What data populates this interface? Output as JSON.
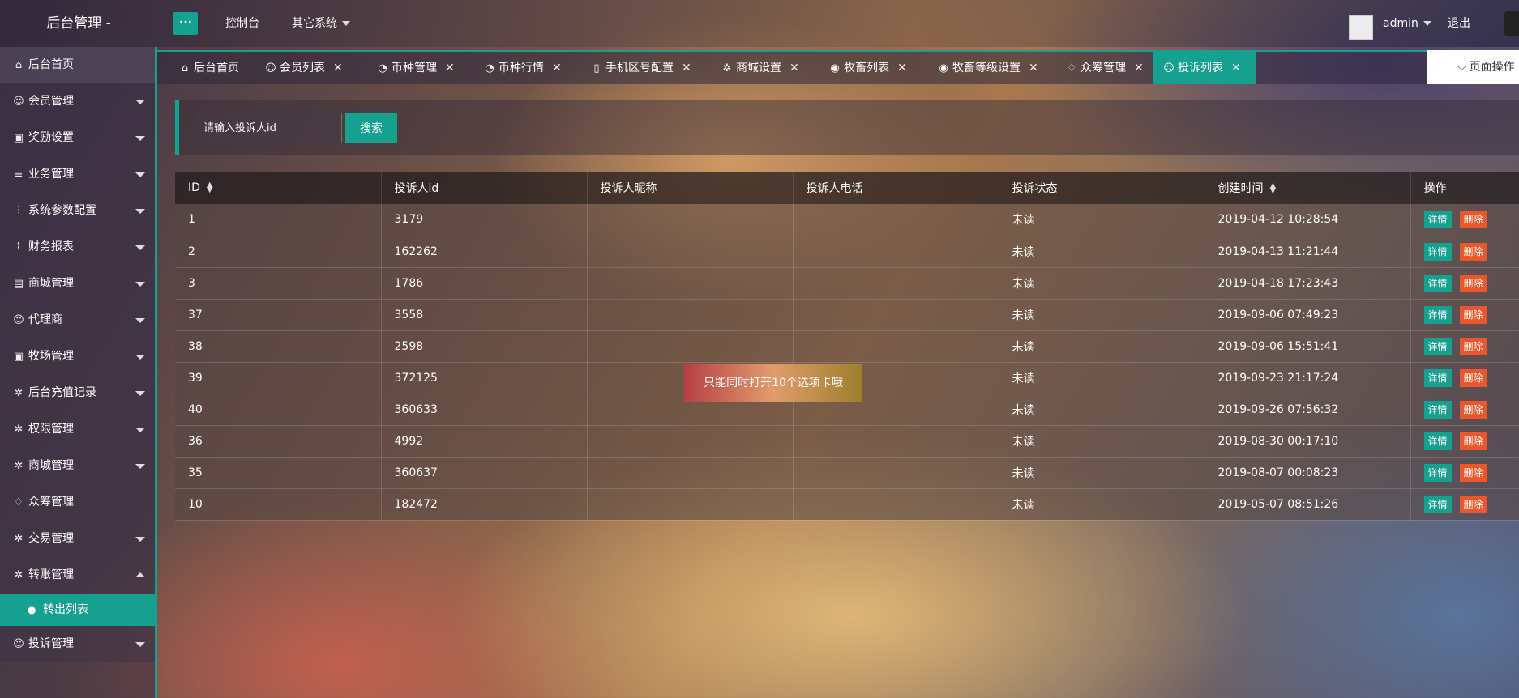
{
  "header": {
    "app_title": "后台管理 -",
    "menu_toggle_label": "···",
    "nav": [
      {
        "label": "控制台"
      },
      {
        "label": "其它系统"
      }
    ],
    "user": "admin",
    "logout": "退出"
  },
  "sidebar": {
    "items": [
      {
        "label": "后台首页",
        "icon": "home-icon",
        "glyph": "⌂"
      },
      {
        "label": "会员管理",
        "icon": "user-icon",
        "glyph": "☺"
      },
      {
        "label": "奖励设置",
        "icon": "gift-icon",
        "glyph": "▣"
      },
      {
        "label": "业务管理",
        "icon": "list-icon",
        "glyph": "≡"
      },
      {
        "label": "系统参数配置",
        "icon": "sliders-icon",
        "glyph": "⫶"
      },
      {
        "label": "财务报表",
        "icon": "chart-icon",
        "glyph": "⌇"
      },
      {
        "label": "商城管理",
        "icon": "shop-icon",
        "glyph": "▤"
      },
      {
        "label": "代理商",
        "icon": "user-icon",
        "glyph": "☺"
      },
      {
        "label": "牧场管理",
        "icon": "gift-icon",
        "glyph": "▣"
      },
      {
        "label": "后台充值记录",
        "icon": "gear-icon",
        "glyph": "✲"
      },
      {
        "label": "权限管理",
        "icon": "gear-icon",
        "glyph": "✲"
      },
      {
        "label": "商城管理",
        "icon": "gear-icon",
        "glyph": "✲"
      },
      {
        "label": "众筹管理",
        "icon": "drops-icon",
        "glyph": "♢"
      },
      {
        "label": "交易管理",
        "icon": "gear-icon",
        "glyph": "✲"
      },
      {
        "label": "转账管理",
        "icon": "gear-icon",
        "glyph": "✲"
      }
    ],
    "sub_item": {
      "label": "转出列表",
      "icon": "person-icon",
      "glyph": "●"
    },
    "last_item": {
      "label": "投诉管理",
      "icon": "smile-icon",
      "glyph": "☺"
    }
  },
  "tabs": [
    {
      "label": "后台首页",
      "icon": "home-icon",
      "glyph": "⌂"
    },
    {
      "label": "会员列表",
      "icon": "user-icon",
      "glyph": "☺"
    },
    {
      "label": "币种管理",
      "icon": "coin-icon",
      "glyph": "◔"
    },
    {
      "label": "币种行情",
      "icon": "coin-icon",
      "glyph": "◔"
    },
    {
      "label": "手机区号配置",
      "icon": "phone-icon",
      "glyph": "▯"
    },
    {
      "label": "商城设置",
      "icon": "gear-icon",
      "glyph": "✲"
    },
    {
      "label": "牧畜列表",
      "icon": "disc-icon",
      "glyph": "◉"
    },
    {
      "label": "牧畜等级设置",
      "icon": "disc-icon",
      "glyph": "◉"
    },
    {
      "label": "众筹管理",
      "icon": "drops-icon",
      "glyph": "♢"
    },
    {
      "label": "投诉列表",
      "icon": "smile-icon",
      "glyph": "☺"
    }
  ],
  "tab_close": "✕",
  "page_ops": "页面操作",
  "search": {
    "placeholder": "请输入投诉人id",
    "button": "搜索"
  },
  "table": {
    "columns": [
      "ID",
      "投诉人id",
      "投诉人昵称",
      "投诉人电话",
      "投诉状态",
      "创建时间",
      "操作"
    ],
    "rows": [
      {
        "id": "1",
        "uid": "3179",
        "nick": "",
        "phone": "",
        "status": "未读",
        "time": "2019-04-12 10:28:54"
      },
      {
        "id": "2",
        "uid": "162262",
        "nick": "",
        "phone": "",
        "status": "未读",
        "time": "2019-04-13 11:21:44"
      },
      {
        "id": "3",
        "uid": "1786",
        "nick": "",
        "phone": "",
        "status": "未读",
        "time": "2019-04-18 17:23:43"
      },
      {
        "id": "37",
        "uid": "3558",
        "nick": "",
        "phone": "",
        "status": "未读",
        "time": "2019-09-06 07:49:23"
      },
      {
        "id": "38",
        "uid": "2598",
        "nick": "",
        "phone": "",
        "status": "未读",
        "time": "2019-09-06 15:51:41"
      },
      {
        "id": "39",
        "uid": "372125",
        "nick": "",
        "phone": "",
        "status": "未读",
        "time": "2019-09-23 21:17:24"
      },
      {
        "id": "40",
        "uid": "360633",
        "nick": "",
        "phone": "",
        "status": "未读",
        "time": "2019-09-26 07:56:32"
      },
      {
        "id": "36",
        "uid": "4992",
        "nick": "",
        "phone": "",
        "status": "未读",
        "time": "2019-08-30 00:17:10"
      },
      {
        "id": "35",
        "uid": "360637",
        "nick": "",
        "phone": "",
        "status": "未读",
        "time": "2019-08-07 00:08:23"
      },
      {
        "id": "10",
        "uid": "182472",
        "nick": "",
        "phone": "",
        "status": "未读",
        "time": "2019-05-07 08:51:26"
      }
    ],
    "detail_label": "详情",
    "delete_label": "删除"
  },
  "toast": "只能同时打开10个选项卡哦",
  "colors": {
    "accent": "#16a08f",
    "danger": "#e9572a"
  }
}
